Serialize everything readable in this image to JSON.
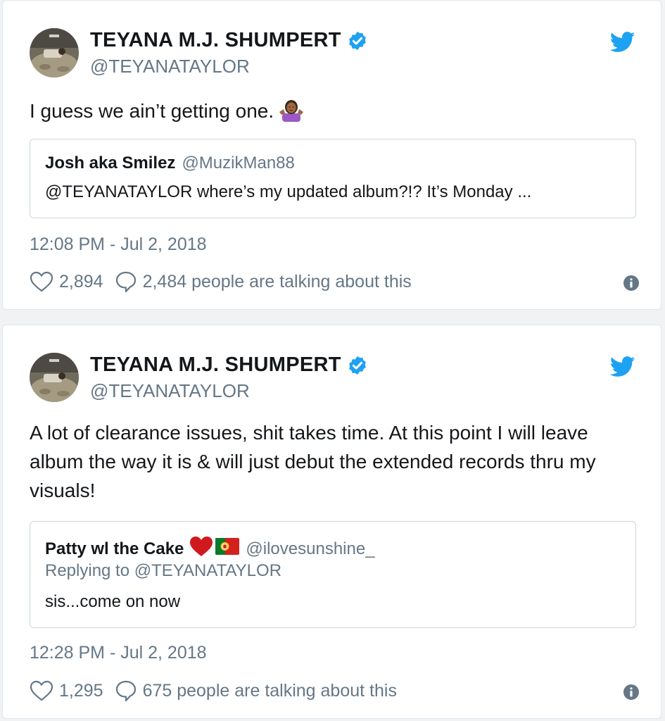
{
  "tweets": [
    {
      "author_name": "TEYANA M.J. SHUMPERT",
      "author_handle": "@TEYANATAYLOR",
      "text": "I guess we ain’t getting one.",
      "quote": {
        "name": "Josh aka Smilez",
        "handle": "@MuzikMan88",
        "text": "@TEYANATAYLOR where’s my updated album?!? It’s Monday ..."
      },
      "timestamp": "12:08 PM - Jul 2, 2018",
      "likes": "2,894",
      "talking": "2,484 people are talking about this"
    },
    {
      "author_name": "TEYANA M.J. SHUMPERT",
      "author_handle": "@TEYANATAYLOR",
      "text": "A lot of clearance issues, shit takes time. At this point I will leave album the way it is & will just debut the extended records thru my visuals!",
      "quote": {
        "name": "Patty wl the Cake",
        "handle": "@ilovesunshine_",
        "replying": "Replying to @TEYANATAYLOR",
        "text": "sis...come on now"
      },
      "timestamp": "12:28 PM - Jul 2, 2018",
      "likes": "1,295",
      "talking": "675 people are talking about this"
    }
  ],
  "colors": {
    "text_primary": "#14171a",
    "text_secondary": "#657786",
    "twitter_blue": "#1da1f2",
    "border": "#e1e8ed"
  },
  "icons": [
    "verified-badge-icon",
    "twitter-bird-icon",
    "heart-outline-icon",
    "comment-bubble-icon",
    "info-icon",
    "person-shrugging-emoji",
    "red-heart-emoji",
    "portugal-flag-emoji"
  ]
}
